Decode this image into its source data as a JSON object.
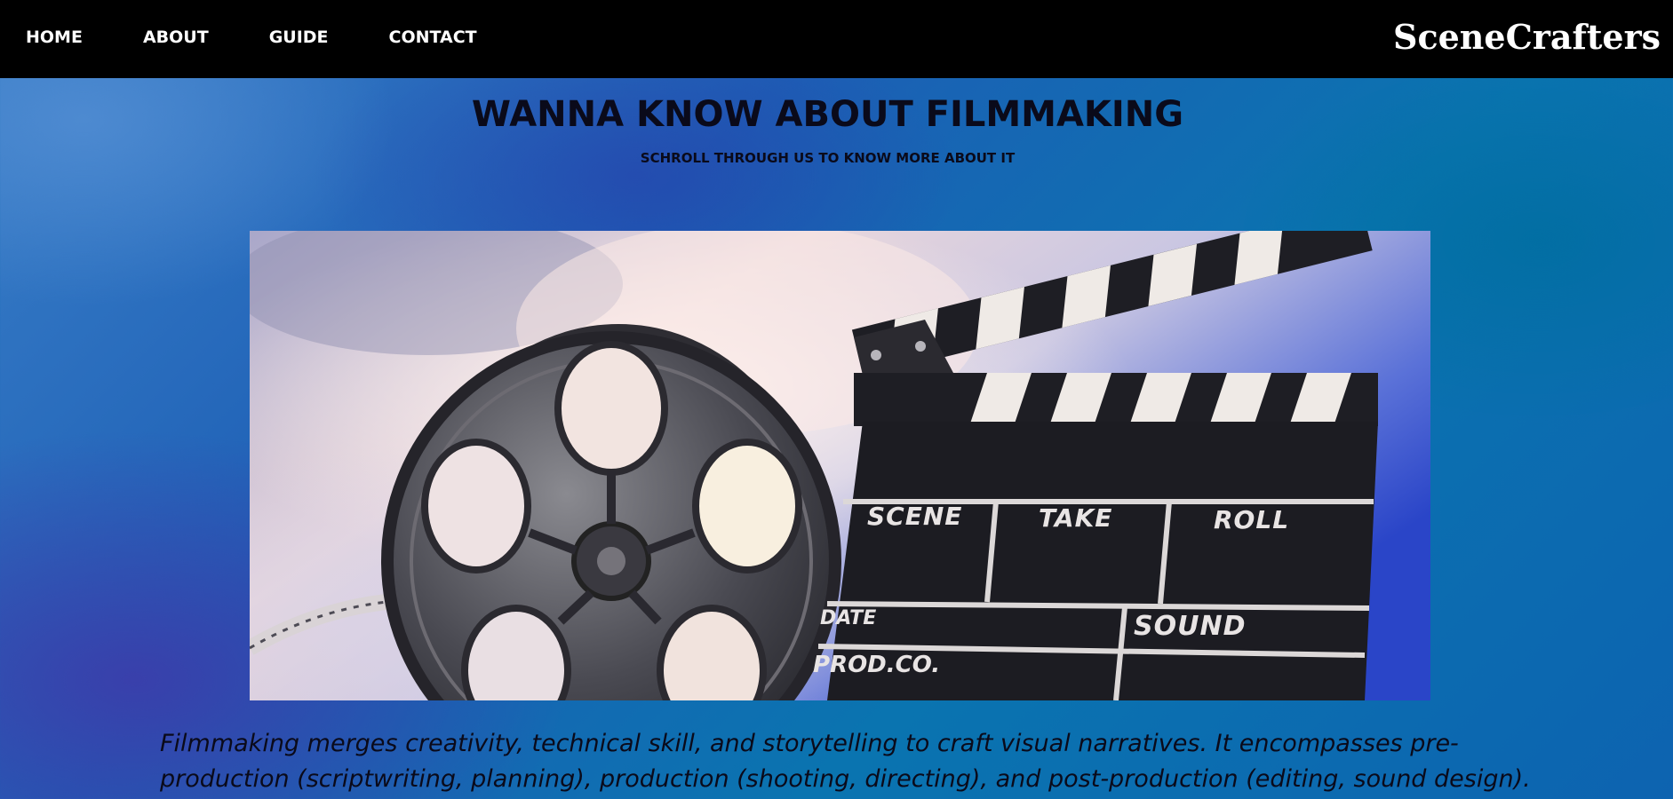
{
  "nav": {
    "links": [
      "HOME",
      "ABOUT",
      "GUIDE",
      "CONTACT"
    ],
    "brand": "SceneCrafters"
  },
  "hero": {
    "title": "WANNA KNOW ABOUT FILMMAKING",
    "subtitle": "SCHROLL THROUGH US TO KNOW MORE ABOUT IT"
  },
  "image": {
    "clapper_labels": {
      "scene": "SCENE",
      "take": "TAKE",
      "roll": "ROLL",
      "date": "DATE",
      "sound": "SOUND",
      "prodco": "PROD.CO."
    }
  },
  "intro": {
    "text": "Filmmaking merges creativity, technical skill, and storytelling to craft visual narratives. It encompasses pre-production (scriptwriting, planning), production (shooting, directing), and post-production (editing, sound design). Collaboration"
  },
  "colors": {
    "navbar": "#000000",
    "background_accent": "#1d5fb5",
    "text_dark": "#0a0a1a"
  }
}
